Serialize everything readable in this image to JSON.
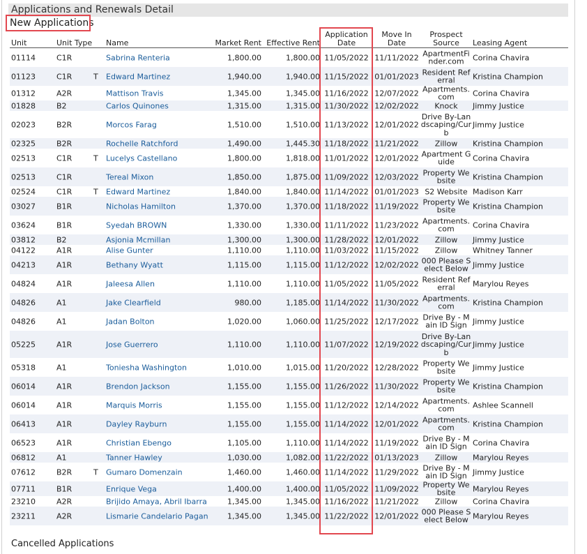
{
  "section_title": "Applications and Renewals Detail",
  "subsection_title": "New Applications",
  "footer_section": "Cancelled Applications",
  "columns": {
    "unit": "Unit",
    "unit_type": "Unit Type",
    "name": "Name",
    "market_rent": "Market Rent",
    "effective_rent": "Effective Rent",
    "application_date": "Application Date",
    "move_in_date": "Move In Date",
    "prospect_source": "Prospect Source",
    "leasing_agent": "Leasing Agent"
  },
  "rows": [
    {
      "unit": "01114",
      "type": "C1R",
      "t": "",
      "name": "Sabrina Renteria",
      "market": "1,800.00",
      "effective": "1,800.00",
      "app": "11/05/2022",
      "move": "11/11/2022",
      "source": "ApartmentFinder.com",
      "agent": "Corina Chavira"
    },
    {
      "unit": "01123",
      "type": "C1R",
      "t": "T",
      "name": "Edward Martinez",
      "market": "1,940.00",
      "effective": "1,940.00",
      "app": "11/15/2022",
      "move": "01/01/2023",
      "source": "Resident Referral",
      "agent": "Kristina Champion"
    },
    {
      "unit": "01312",
      "type": "A2R",
      "t": "",
      "name": "Mattison Travis",
      "market": "1,345.00",
      "effective": "1,345.00",
      "app": "11/16/2022",
      "move": "12/07/2022",
      "source": "Apartments.com",
      "agent": "Corina Chavira"
    },
    {
      "unit": "01828",
      "type": "B2",
      "t": "",
      "name": "Carlos Quinones",
      "market": "1,315.00",
      "effective": "1,315.00",
      "app": "11/30/2022",
      "move": "12/02/2022",
      "source": "Knock",
      "agent": "Jimmy Justice"
    },
    {
      "unit": "02023",
      "type": "B2R",
      "t": "",
      "name": "Morcos Farag",
      "market": "1,510.00",
      "effective": "1,510.00",
      "app": "11/13/2022",
      "move": "12/01/2022",
      "source": "Drive By-Landscaping/Curb",
      "agent": "Jimmy Justice"
    },
    {
      "unit": "02325",
      "type": "B2R",
      "t": "",
      "name": "Rochelle Ratchford",
      "market": "1,490.00",
      "effective": "1,445.30",
      "app": "11/18/2022",
      "move": "11/21/2022",
      "source": "Zillow",
      "agent": "Kristina Champion"
    },
    {
      "unit": "02513",
      "type": "C1R",
      "t": "T",
      "name": "Lucelys Castellano",
      "market": "1,800.00",
      "effective": "1,818.00",
      "app": "11/01/2022",
      "move": "12/01/2022",
      "source": "Apartment Guide",
      "agent": "Corina Chavira"
    },
    {
      "unit": "02513",
      "type": "C1R",
      "t": "",
      "name": "Tereal Mixon",
      "market": "1,850.00",
      "effective": "1,875.00",
      "app": "11/09/2022",
      "move": "12/03/2022",
      "source": "Property Website",
      "agent": "Kristina Champion"
    },
    {
      "unit": "02524",
      "type": "C1R",
      "t": "T",
      "name": "Edward Martinez",
      "market": "1,840.00",
      "effective": "1,840.00",
      "app": "11/14/2022",
      "move": "01/01/2023",
      "source": "S2 Website",
      "agent": "Madison Karr"
    },
    {
      "unit": "03027",
      "type": "B1R",
      "t": "",
      "name": "Nicholas Hamilton",
      "market": "1,370.00",
      "effective": "1,370.00",
      "app": "11/18/2022",
      "move": "11/19/2022",
      "source": "Property Website",
      "agent": "Kristina Champion"
    },
    {
      "unit": "03624",
      "type": "B1R",
      "t": "",
      "name": "Syedah BROWN",
      "market": "1,330.00",
      "effective": "1,330.00",
      "app": "11/11/2022",
      "move": "11/23/2022",
      "source": "Apartments.com",
      "agent": "Corina Chavira"
    },
    {
      "unit": "03812",
      "type": "B2",
      "t": "",
      "name": "Asjonia Mcmillan",
      "market": "1,300.00",
      "effective": "1,300.00",
      "app": "11/28/2022",
      "move": "12/01/2022",
      "source": "Zillow",
      "agent": "Jimmy Justice"
    },
    {
      "unit": "04122",
      "type": "A1R",
      "t": "",
      "name": "Alise Gunter",
      "market": "1,110.00",
      "effective": "1,110.00",
      "app": "11/03/2022",
      "move": "11/15/2022",
      "source": "Zillow",
      "agent": "Whitney Tanner"
    },
    {
      "unit": "04213",
      "type": "A1R",
      "t": "",
      "name": "Bethany Wyatt",
      "market": "1,115.00",
      "effective": "1,115.00",
      "app": "11/12/2022",
      "move": "12/02/2022",
      "source": "000 Please Select Below",
      "agent": "Jimmy Justice"
    },
    {
      "unit": "04824",
      "type": "A1R",
      "t": "",
      "name": "Jaleesa Allen",
      "market": "1,110.00",
      "effective": "1,110.00",
      "app": "11/05/2022",
      "move": "11/05/2022",
      "source": "Resident Referral",
      "agent": "Marylou Reyes"
    },
    {
      "unit": "04826",
      "type": "A1",
      "t": "",
      "name": "Jake Clearfield",
      "market": "980.00",
      "effective": "1,185.00",
      "app": "11/14/2022",
      "move": "11/30/2022",
      "source": "Apartments.com",
      "agent": "Kristina Champion"
    },
    {
      "unit": "04826",
      "type": "A1",
      "t": "",
      "name": "Jadan Bolton",
      "market": "1,020.00",
      "effective": "1,060.00",
      "app": "11/25/2022",
      "move": "12/17/2022",
      "source": "Drive By - Main ID Sign",
      "agent": "Jimmy Justice"
    },
    {
      "unit": "05225",
      "type": "A1R",
      "t": "",
      "name": "Jose Guerrero",
      "market": "1,110.00",
      "effective": "1,110.00",
      "app": "11/07/2022",
      "move": "12/19/2022",
      "source": "Drive By-Landscaping/Curb",
      "agent": "Jimmy Justice"
    },
    {
      "unit": "05318",
      "type": "A1",
      "t": "",
      "name": "Toniesha Washington",
      "market": "1,010.00",
      "effective": "1,015.00",
      "app": "11/20/2022",
      "move": "12/28/2022",
      "source": "Property Website",
      "agent": "Jimmy Justice"
    },
    {
      "unit": "06014",
      "type": "A1R",
      "t": "",
      "name": "Brendon Jackson",
      "market": "1,155.00",
      "effective": "1,155.00",
      "app": "11/26/2022",
      "move": "11/30/2022",
      "source": "Property Website",
      "agent": "Kristina Champion"
    },
    {
      "unit": "06014",
      "type": "A1R",
      "t": "",
      "name": "Marquis Morris",
      "market": "1,155.00",
      "effective": "1,155.00",
      "app": "11/12/2022",
      "move": "12/14/2022",
      "source": "Apartments.com",
      "agent": "Ashlee Scannell"
    },
    {
      "unit": "06413",
      "type": "A1R",
      "t": "",
      "name": "Dayley Rayburn",
      "market": "1,155.00",
      "effective": "1,155.00",
      "app": "11/14/2022",
      "move": "12/01/2022",
      "source": "Apartments.com",
      "agent": "Kristina Champion"
    },
    {
      "unit": "06523",
      "type": "A1R",
      "t": "",
      "name": "Christian Ebengo",
      "market": "1,105.00",
      "effective": "1,110.00",
      "app": "11/14/2022",
      "move": "11/19/2022",
      "source": "Drive By - Main ID Sign",
      "agent": "Corina Chavira"
    },
    {
      "unit": "06812",
      "type": "A1",
      "t": "",
      "name": "Tanner Hawley",
      "market": "1,030.00",
      "effective": "1,082.00",
      "app": "11/22/2022",
      "move": "01/13/2023",
      "source": "Zillow",
      "agent": "Marylou Reyes"
    },
    {
      "unit": "07612",
      "type": "B2R",
      "t": "T",
      "name": "Gumaro Domenzain",
      "market": "1,460.00",
      "effective": "1,460.00",
      "app": "11/14/2022",
      "move": "11/29/2022",
      "source": "Drive By - Main ID Sign",
      "agent": "Jimmy Justice"
    },
    {
      "unit": "07711",
      "type": "B1R",
      "t": "",
      "name": "Enrique Vega",
      "market": "1,400.00",
      "effective": "1,400.00",
      "app": "11/05/2022",
      "move": "11/09/2022",
      "source": "Property Website",
      "agent": "Marylou Reyes"
    },
    {
      "unit": "23210",
      "type": "A2R",
      "t": "",
      "name": "Brijido Amaya, Abril Ibarra",
      "market": "1,345.00",
      "effective": "1,345.00",
      "app": "11/16/2022",
      "move": "11/21/2022",
      "source": "Zillow",
      "agent": "Corina Chavira"
    },
    {
      "unit": "23211",
      "type": "A2R",
      "t": "",
      "name": "Lismarie Candelario Pagan",
      "market": "1,345.00",
      "effective": "1,345.00",
      "app": "11/22/2022",
      "move": "12/01/2022",
      "source": "000 Please Select Below",
      "agent": "Marylou Reyes"
    }
  ]
}
